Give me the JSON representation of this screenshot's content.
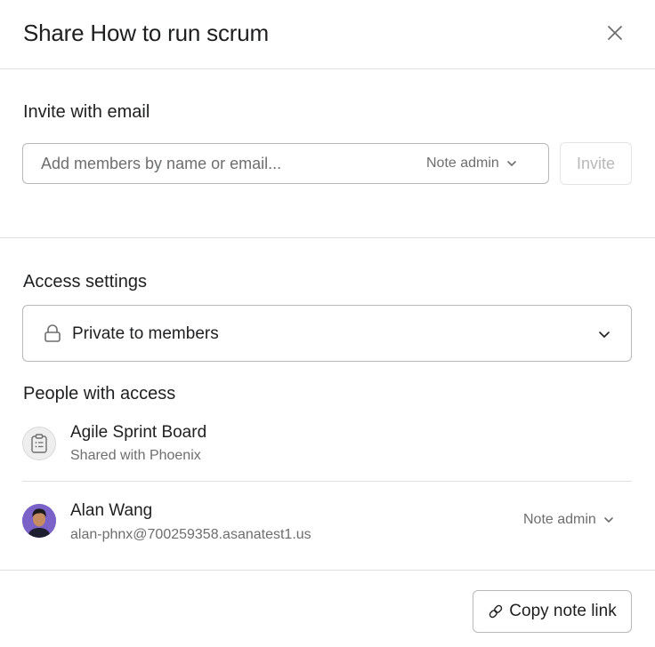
{
  "dialog": {
    "title": "Share How to run scrum",
    "close_icon": "close-icon"
  },
  "invite": {
    "heading": "Invite with email",
    "placeholder": "Add members by name or email...",
    "role_label": "Note admin",
    "button_label": "Invite"
  },
  "access": {
    "heading": "Access settings",
    "selected": "Private to members",
    "icon": "lock-icon"
  },
  "people": {
    "heading": "People with access",
    "items": [
      {
        "name": "Agile Sprint Board",
        "sub": "Shared with Phoenix",
        "icon": "clipboard-icon"
      },
      {
        "name": "Alan Wang",
        "sub": "alan-phnx@700259358.asanatest1.us",
        "role": "Note admin"
      }
    ]
  },
  "footer": {
    "copy_label": "Copy note link",
    "copy_icon": "link-icon"
  },
  "colors": {
    "text": "#1e1f21",
    "muted": "#6d6e6f",
    "border": "#b9b8b8",
    "divider": "#e0e0e0"
  }
}
